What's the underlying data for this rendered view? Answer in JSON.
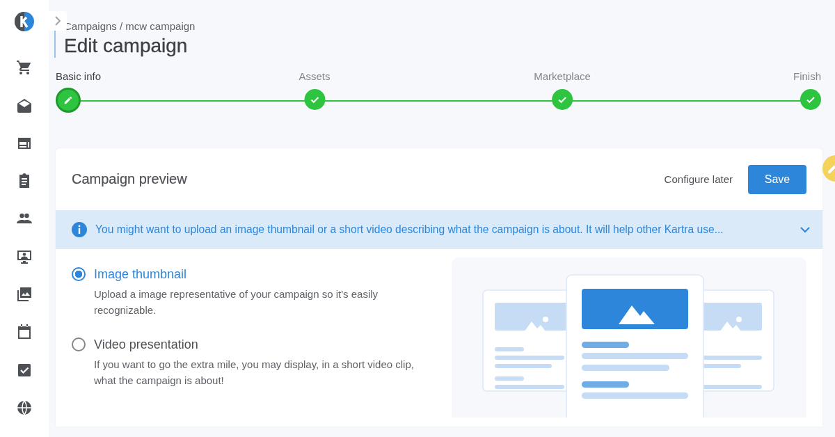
{
  "breadcrumb": "Campaigns / mcw campaign",
  "title": "Edit campaign",
  "steps": [
    {
      "label": "Basic info",
      "selected": true,
      "completed": false
    },
    {
      "label": "Assets",
      "selected": false,
      "completed": true
    },
    {
      "label": "Marketplace",
      "selected": false,
      "completed": true
    },
    {
      "label": "Finish",
      "selected": false,
      "completed": true
    }
  ],
  "card": {
    "title": "Campaign preview",
    "secondary_button": "Configure later",
    "primary_button": "Save",
    "notice": {
      "text": "You might want to upload an image thumbnail or a short video describing what the campaign is about. It will help other Kartra use...",
      "expanded": false
    },
    "options": [
      {
        "label": "Image thumbnail",
        "description": "Upload a image representative of your campaign so it's easily recognizable.",
        "selected": true
      },
      {
        "label": "Video presentation",
        "description": "If you want to go the extra mile, you may display, in a short video clip, what the campaign is about!",
        "selected": false
      }
    ]
  }
}
